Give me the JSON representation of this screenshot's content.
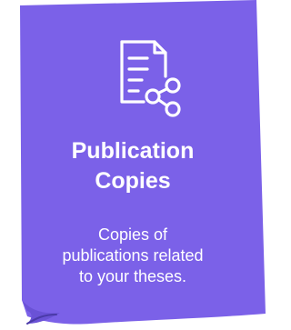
{
  "card": {
    "background_color": "#7b61e8",
    "icon": "document-share-icon",
    "title_lines": [
      "Publication",
      "Copies"
    ],
    "description_lines": [
      "Copies of",
      "publications related",
      "to your theses."
    ]
  }
}
